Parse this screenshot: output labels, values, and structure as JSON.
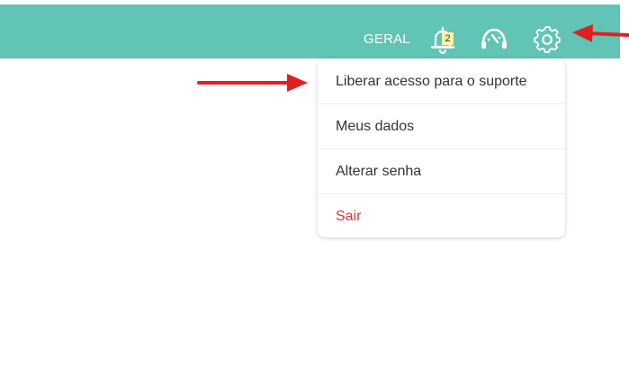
{
  "header": {
    "section_label": "GERAL",
    "notification_count": "2",
    "bell_icon": "bell-icon",
    "support_icon": "headset-support-icon",
    "settings_icon": "gear-icon"
  },
  "menu": {
    "items": [
      {
        "label": "Liberar acesso para o suporte",
        "style": "normal"
      },
      {
        "label": "Meus dados",
        "style": "normal"
      },
      {
        "label": "Alterar senha",
        "style": "normal"
      },
      {
        "label": "Sair",
        "style": "danger"
      }
    ]
  },
  "annotations": {
    "arrow_color": "#e02020",
    "arrow_icon": "red-arrow-icon"
  },
  "colors": {
    "accent": "#61c4b4",
    "danger": "#d9343c",
    "badge": "#fbf3a6"
  }
}
